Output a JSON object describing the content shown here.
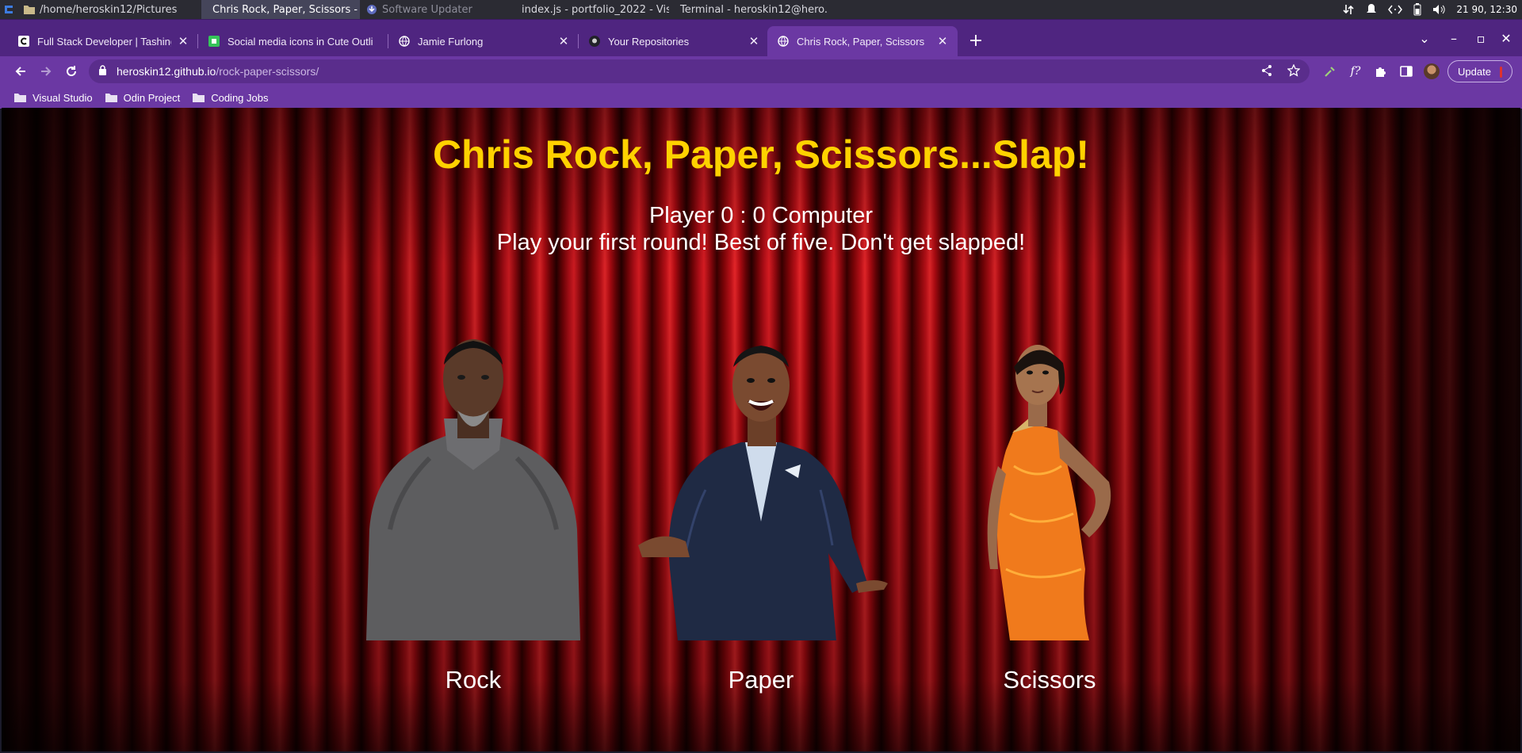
{
  "taskbar": {
    "tasks": [
      {
        "label": "/home/heroskin12/Pictures",
        "icon": "folder-icon",
        "state": "normal"
      },
      {
        "label": "Chris Rock, Paper, Scissors - ...",
        "icon": "chrome-icon",
        "state": "active"
      },
      {
        "label": "Software Updater",
        "icon": "updater-icon",
        "state": "dim"
      },
      {
        "label": "index.js - portfolio_2022 - Vis...",
        "icon": "vscode-icon",
        "state": "normal"
      },
      {
        "label": "Terminal - heroskin12@hero...",
        "icon": "terminal-icon",
        "state": "normal"
      }
    ],
    "clock": "21 90, 12:30"
  },
  "browser": {
    "tabs": [
      {
        "title": "Full Stack Developer | Tashinga",
        "icon": "site-c-icon"
      },
      {
        "title": "Social media icons in Cute Outli",
        "icon": "green-square-icon"
      },
      {
        "title": "Jamie Furlong",
        "icon": "globe-icon"
      },
      {
        "title": "Your Repositories",
        "icon": "github-icon"
      },
      {
        "title": "Chris Rock, Paper, Scissors",
        "icon": "globe-icon",
        "active": true
      }
    ],
    "address": {
      "host": "heroskin12.github.io",
      "path": "/rock-paper-scissors/"
    },
    "update_label": "Update",
    "bookmarks": [
      {
        "label": "Visual Studio"
      },
      {
        "label": "Odin Project"
      },
      {
        "label": "Coding Jobs"
      }
    ],
    "accent_color": "#6b38a3"
  },
  "game": {
    "title": "Chris Rock, Paper, Scissors...Slap!",
    "score": {
      "text": "Player 0 : 0 Computer",
      "player": 0,
      "computer": 0
    },
    "message": "Play your first round! Best of five. Don't get slapped!",
    "choices": [
      {
        "label": "Rock"
      },
      {
        "label": "Paper"
      },
      {
        "label": "Scissors"
      }
    ],
    "title_color": "#ffd200"
  }
}
